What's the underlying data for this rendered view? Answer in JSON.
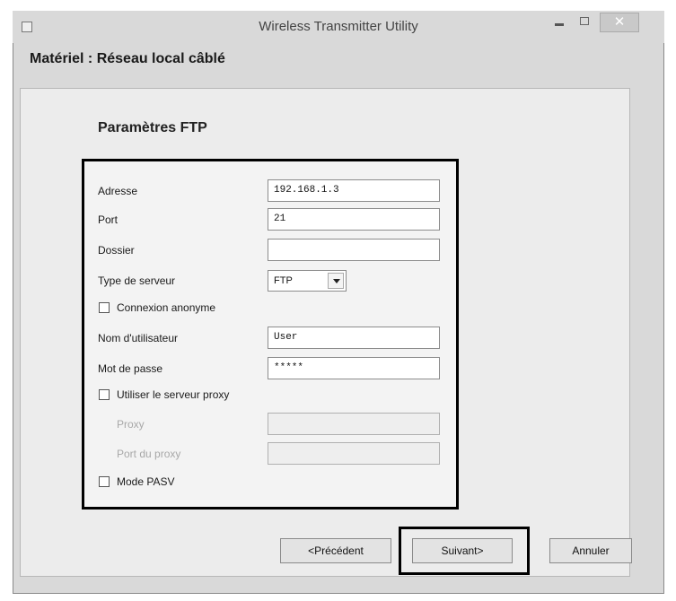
{
  "window": {
    "title": "Wireless Transmitter Utility",
    "close_glyph": "✕"
  },
  "header": {
    "label": "Matériel : Réseau local câblé"
  },
  "section": {
    "title": "Paramètres FTP"
  },
  "form": {
    "address_label": "Adresse",
    "address_value": "192.168.1.3",
    "port_label": "Port",
    "port_value": "21",
    "folder_label": "Dossier",
    "folder_value": "",
    "server_type_label": "Type de serveur",
    "server_type_value": "FTP",
    "anonymous_label": "Connexion anonyme",
    "anonymous_checked": false,
    "username_label": "Nom d'utilisateur",
    "username_value": "User",
    "password_label": "Mot de passe",
    "password_value": "*****",
    "use_proxy_label": "Utiliser le serveur proxy",
    "use_proxy_checked": false,
    "proxy_label": "Proxy",
    "proxy_value": "",
    "proxy_port_label": "Port du proxy",
    "proxy_port_value": "",
    "pasv_label": "Mode PASV",
    "pasv_checked": false
  },
  "buttons": {
    "previous": "<Précédent",
    "next": "Suivant>",
    "cancel": "Annuler"
  }
}
